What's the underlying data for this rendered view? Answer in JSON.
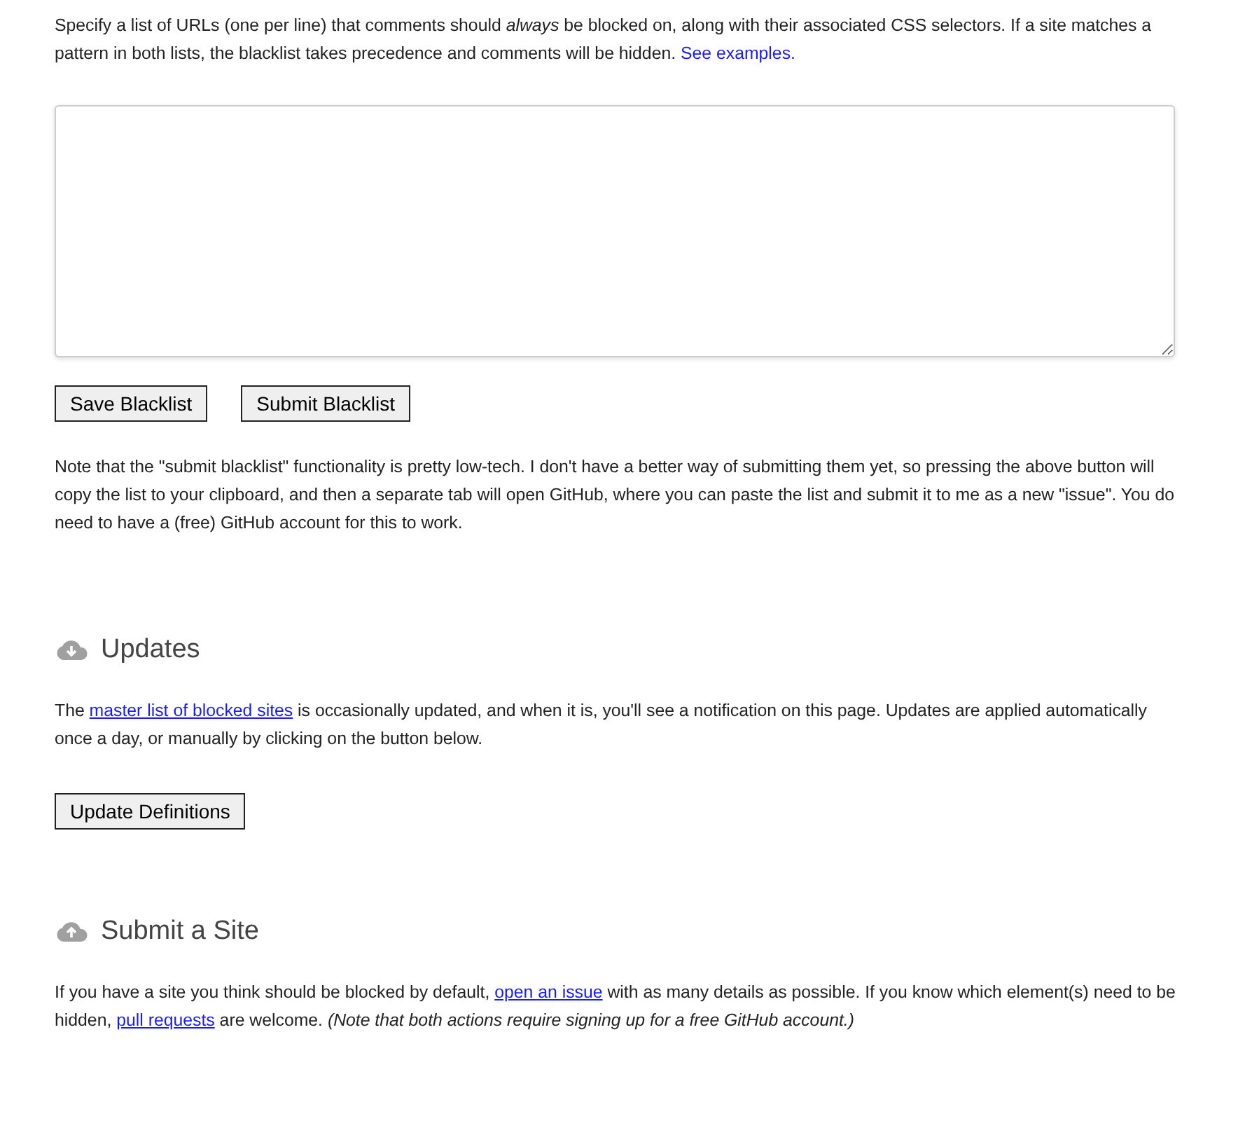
{
  "intro": [
    {
      "kind": "text",
      "text": "Specify a list of URLs (one per line) that comments should *always* be blocked on, along with their associated CSS selectors. If a site matches a pattern in both lists, the blacklist takes precedence and comments will be hidden. "
    },
    {
      "kind": "plain-link",
      "text": "See examples."
    }
  ],
  "blacklist_buttons": [
    "Save Blacklist",
    "Submit Blacklist"
  ],
  "note": [
    {
      "kind": "text",
      "text": "Note that the \"submit blacklist\" functionality is pretty low-tech. I don't have a better way of submitting them yet, so pressing the above button will copy the list to your clipboard, and then a separate tab will open GitHub, where you can paste the list and submit it to me as a new \"issue\". You do need to have a (free) GitHub account for this to work."
    }
  ],
  "sections": [
    {
      "kind": "download",
      "title": "Updates",
      "text": [
        {
          "kind": "text",
          "text": "The "
        },
        {
          "kind": "link",
          "text": "master list of blocked sites"
        },
        {
          "kind": "text",
          "text": " is occasionally updated, and when it is, you'll see a notification on this page. Updates are applied automatically once a day, or manually by clicking on the button below."
        }
      ],
      "button": "Update Definitions"
    },
    {
      "kind": "upload",
      "title": "Submit a Site",
      "text": [
        {
          "kind": "text",
          "text": "If you have a site you think should be blocked by default, "
        },
        {
          "kind": "link",
          "text": "open an issue"
        },
        {
          "kind": "text",
          "text": " with as many details as possible. If you know which element(s) need to be hidden, "
        },
        {
          "kind": "link",
          "text": "pull requests"
        },
        {
          "kind": "text",
          "text": " are welcome. *(Note that both actions require signing up for a free GitHub account.)*"
        }
      ]
    }
  ]
}
